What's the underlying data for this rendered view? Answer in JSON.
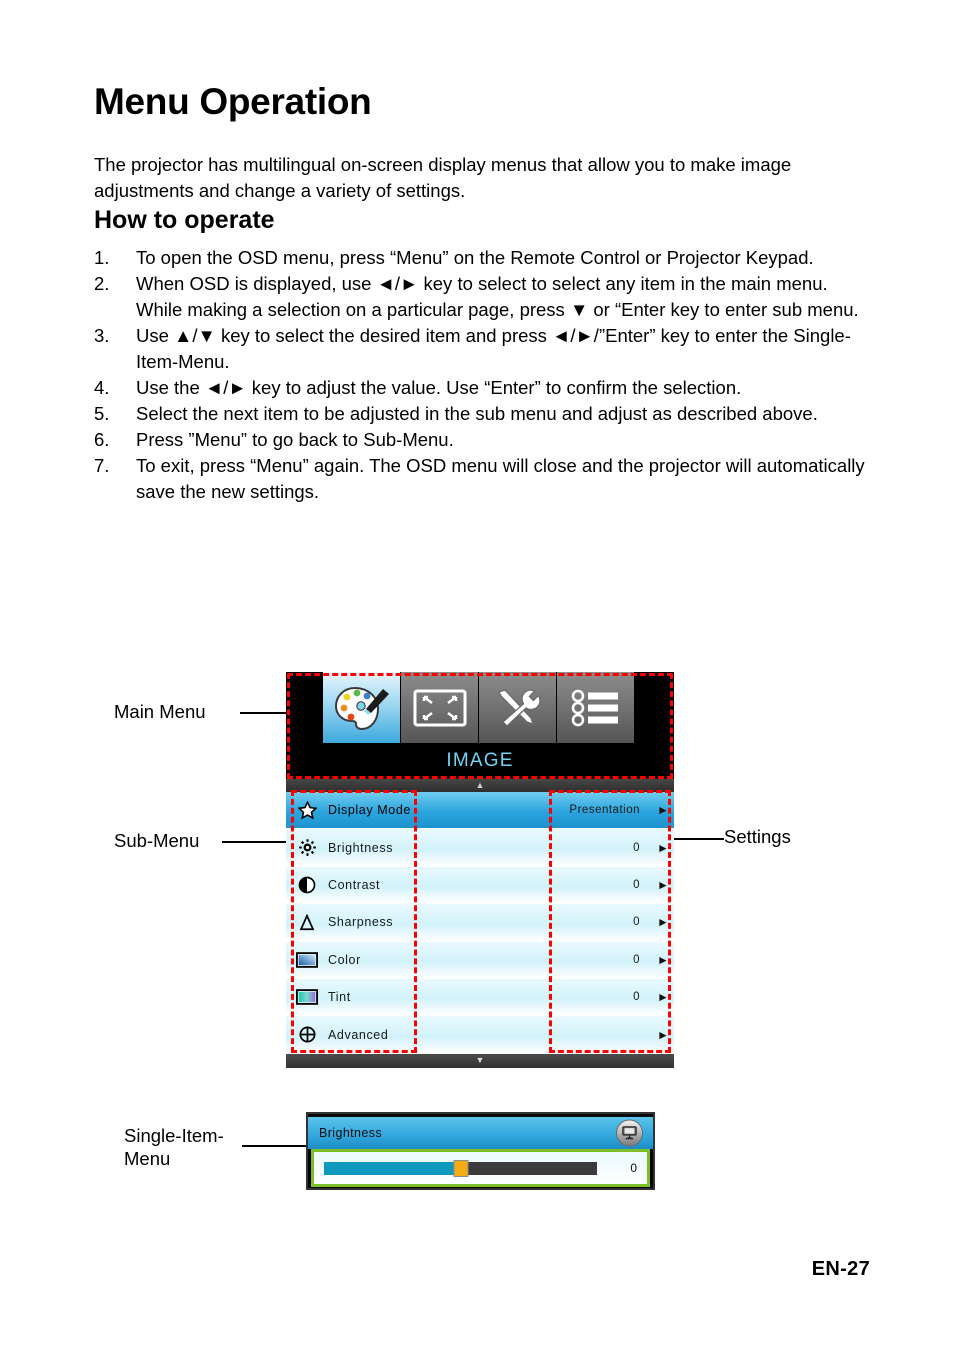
{
  "document": {
    "title": "Menu Operation",
    "intro": "The projector has multilingual on-screen display menus that allow you to make image adjustments and change a variety of settings.",
    "subheading": "How to operate",
    "page_label": "EN-27"
  },
  "steps": [
    {
      "num": "1.",
      "text": "To open the OSD menu, press “Menu” on the Remote Control or Projector Keypad."
    },
    {
      "num": "2.",
      "text": "When OSD is displayed, use ◄/► key to select to select any item in the main menu. While making a selection on a particular page, press ▼ or “Enter key to enter sub menu."
    },
    {
      "num": "3.",
      "text": "Use ▲/▼ key to select the desired item and press ◄/►/”Enter” key to enter the Single-Item-Menu."
    },
    {
      "num": "4.",
      "text": "Use the ◄/► key to adjust the value. Use “Enter” to confirm the selection."
    },
    {
      "num": "5.",
      "text": "Select the next item to be adjusted in the sub menu and adjust as described above."
    },
    {
      "num": "6.",
      "text": "Press ”Menu” to go back to Sub-Menu."
    },
    {
      "num": "7.",
      "text": "To exit, press “Menu” again. The OSD menu will close and the projector will automatically save the new settings."
    }
  ],
  "callouts": {
    "main_menu": "Main Menu",
    "sub_menu": "Sub-Menu",
    "settings": "Settings",
    "single_item_menu": "Single-Item-\nMenu"
  },
  "osd": {
    "title": "IMAGE",
    "scroll_up": "▲",
    "scroll_down": "▼",
    "main_menu_icons": [
      {
        "name": "palette-icon",
        "label": "Image",
        "selected": true
      },
      {
        "name": "screen-resize-icon",
        "label": "Display",
        "selected": false
      },
      {
        "name": "tools-icon",
        "label": "Setup",
        "selected": false
      },
      {
        "name": "list-options-icon",
        "label": "Options",
        "selected": false
      }
    ],
    "rows": [
      {
        "icon": "star-icon",
        "label": "Display Mode",
        "value": "Presentation",
        "arrow": "►",
        "active": true
      },
      {
        "icon": "sun-icon",
        "label": "Brightness",
        "value": "0",
        "arrow": "►",
        "active": false
      },
      {
        "icon": "contrast-icon",
        "label": "Contrast",
        "value": "0",
        "arrow": "►",
        "active": false
      },
      {
        "icon": "sharpness-icon",
        "label": "Sharpness",
        "value": "0",
        "arrow": "►",
        "active": false
      },
      {
        "icon": "color-icon",
        "label": "Color",
        "value": "0",
        "arrow": "►",
        "active": false
      },
      {
        "icon": "tint-icon",
        "label": "Tint",
        "value": "0",
        "arrow": "►",
        "active": false
      },
      {
        "icon": "advanced-icon",
        "label": "Advanced",
        "value": "",
        "arrow": "►",
        "active": false
      }
    ]
  },
  "single_item_menu": {
    "title": "Brightness",
    "badge_icon": "projector-screen-icon",
    "value": "0",
    "slider_percent": 50
  },
  "colors": {
    "annotation_red": "#ff0000",
    "osd_title_cyan": "#6fd4f5",
    "row_active_blue": "#2ba4dd",
    "row_blue": "#d2f2fa",
    "slider_fill": "#0f99bd",
    "slider_thumb": "#f5ac12",
    "single_item_border_green": "#7dbf28"
  }
}
